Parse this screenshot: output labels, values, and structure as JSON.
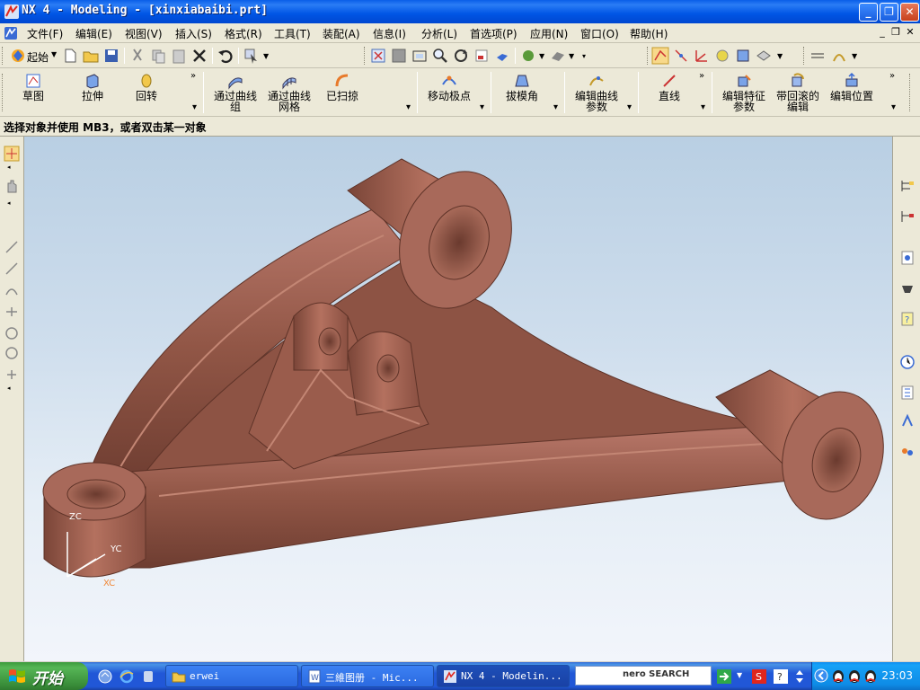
{
  "window": {
    "title": "NX 4 - Modeling - [xinxiabaibi.prt]"
  },
  "menu": {
    "items": [
      "文件(F)",
      "编辑(E)",
      "视图(V)",
      "插入(S)",
      "格式(R)",
      "工具(T)",
      "装配(A)",
      "信息(I)",
      "分析(L)",
      "首选项(P)",
      "应用(N)",
      "窗口(O)",
      "帮助(H)"
    ]
  },
  "toolbar1": {
    "start_label": "起始"
  },
  "toolbar2": {
    "items": [
      {
        "label": "草图"
      },
      {
        "label": "拉伸"
      },
      {
        "label": "回转"
      },
      {
        "label": "通过曲线\n组"
      },
      {
        "label": "通过曲线\n网格"
      },
      {
        "label": "已扫掠"
      },
      {
        "label": "移动极点"
      },
      {
        "label": "拔模角"
      },
      {
        "label": "编辑曲线\n参数"
      },
      {
        "label": "直线"
      },
      {
        "label": "编辑特征\n参数"
      },
      {
        "label": "带回滚的\n编辑"
      },
      {
        "label": "编辑位置"
      }
    ]
  },
  "prompt": {
    "text": "选择对象并使用 MB3，或者双击某一对象"
  },
  "viewport": {
    "triad": {
      "zc": "ZC",
      "yc": "YC",
      "xc": "XC"
    },
    "part_color": "#8d5344"
  },
  "taskbar": {
    "start_label": "开始",
    "tasks": [
      {
        "label": "erwei"
      },
      {
        "label": "三維图册 - Mic..."
      },
      {
        "label": "NX 4 - Modelin..."
      }
    ],
    "search_label": "nero SEARCH",
    "clock": "23:03"
  }
}
